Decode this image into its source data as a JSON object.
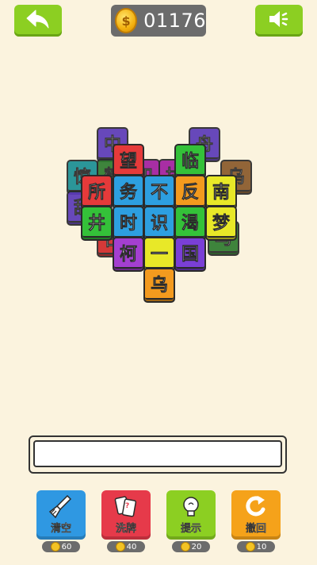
{
  "header": {
    "coin_symbol": "$",
    "coins": "01176",
    "back_icon": "back-arrow-icon",
    "sound_icon": "speaker-icon"
  },
  "board": {
    "back_tiles": [
      {
        "char": "中",
        "color": "#5b3ab8"
      },
      {
        "char": "舟",
        "color": "#5b3ab8"
      },
      {
        "char": "惊",
        "color": "#1a8f94"
      },
      {
        "char": "乌",
        "color": "#8a5a2b"
      },
      {
        "char": "甜",
        "color": "#5b3ab8"
      },
      {
        "char": "鹤",
        "color": "#2f7b2f"
      },
      {
        "char": "和",
        "color": "#a11ea0"
      },
      {
        "char": "执",
        "color": "#a11ea0"
      },
      {
        "char": "日",
        "color": "#d02a2a"
      },
      {
        "char": "马",
        "color": "#2f7b2f"
      }
    ],
    "front_tiles": [
      {
        "char": "望",
        "color": "#e53a3a"
      },
      {
        "char": "临",
        "color": "#34c139"
      },
      {
        "char": "所",
        "color": "#e53a3a"
      },
      {
        "char": "务",
        "color": "#2d9fe0"
      },
      {
        "char": "不",
        "color": "#2d9fe0"
      },
      {
        "char": "反",
        "color": "#f39a1e"
      },
      {
        "char": "南",
        "color": "#e8e828"
      },
      {
        "char": "井",
        "color": "#34c139"
      },
      {
        "char": "时",
        "color": "#2d9fe0"
      },
      {
        "char": "识",
        "color": "#2d9fe0"
      },
      {
        "char": "渴",
        "color": "#34c139"
      },
      {
        "char": "梦",
        "color": "#e8e828"
      },
      {
        "char": "柯",
        "color": "#a43fd0"
      },
      {
        "char": "一",
        "color": "#e8e828"
      },
      {
        "char": "国",
        "color": "#7a3fd6"
      },
      {
        "char": "乌",
        "color": "#f39a1e"
      }
    ]
  },
  "tools": [
    {
      "label": "清空",
      "cost": "60",
      "color": "#2f98e2",
      "icon": "brush-icon"
    },
    {
      "label": "洗牌",
      "cost": "40",
      "color": "#e63a4a",
      "icon": "shuffle-cards-icon"
    },
    {
      "label": "提示",
      "cost": "20",
      "color": "#8ccf22",
      "icon": "lightbulb-icon"
    },
    {
      "label": "撤回",
      "cost": "10",
      "color": "#f5a21a",
      "icon": "undo-icon"
    }
  ]
}
